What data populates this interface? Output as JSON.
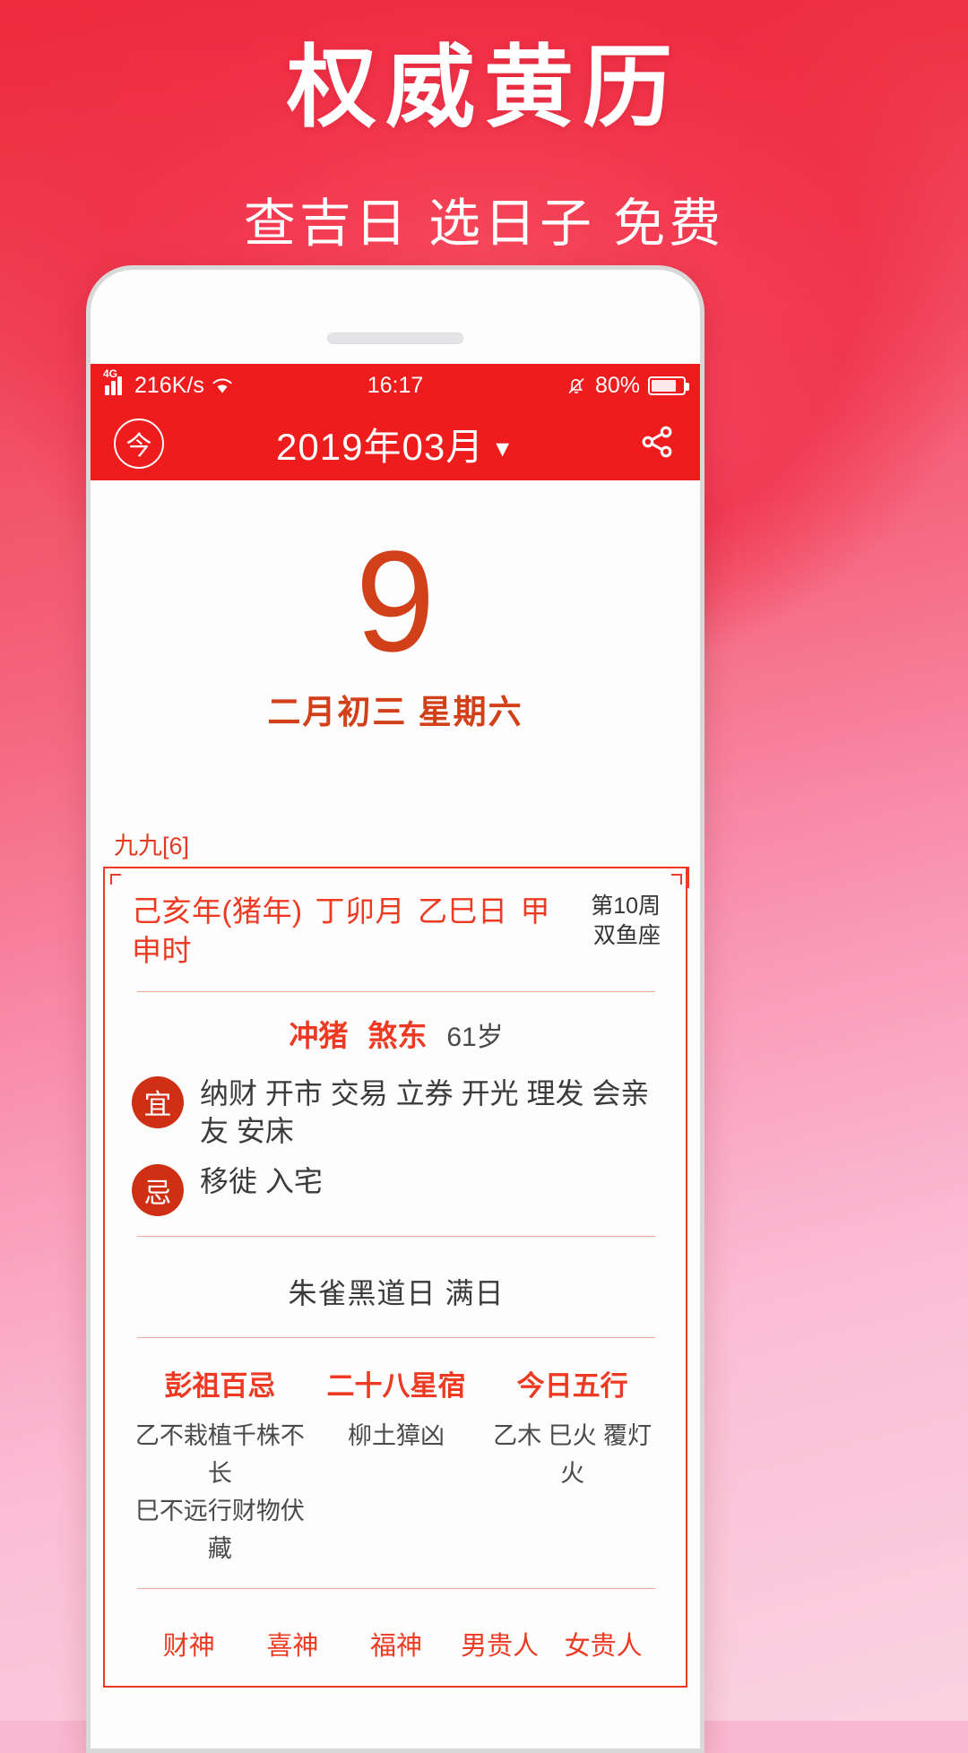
{
  "promo": {
    "title": "权威黄历",
    "subtitle": "查吉日 选日子 免费"
  },
  "colors": {
    "brand_red": "#ee1c1c",
    "accent_orange": "#ee3a22",
    "date_orange": "#d2401a",
    "badge_red": "#cf3014"
  },
  "statusbar": {
    "network_type": "4G",
    "speed": "216K/s",
    "wifi_icon": "wifi-icon",
    "signal_icon": "signal-bars-icon",
    "time": "16:17",
    "mute_icon": "bell-mute-icon",
    "battery_percent": "80%",
    "battery_icon": "battery-icon"
  },
  "appbar": {
    "today_button": "今",
    "title": "2019年03月",
    "caret": "▼",
    "share_icon": "share-icon"
  },
  "bigdate": {
    "day": "9",
    "lunar_and_weekday": "二月初三  星期六"
  },
  "almanac": {
    "jiujiu_label": "九九[6]",
    "ganzhi": [
      "己亥年(猪年)",
      "丁卯月",
      "乙巳日",
      "甲申时"
    ],
    "week_of_year": "第10周",
    "zodiac_sign": "双鱼座",
    "chong": "冲猪",
    "sha": "煞东",
    "age": "61岁",
    "yi_label": "宜",
    "yi_text": "纳财 开市 交易 立券 开光 理发 会亲友 安床",
    "ji_label": "忌",
    "ji_text": "移徙 入宅",
    "huangdao": "朱雀黑道日   满日",
    "columns": [
      {
        "title": "彭祖百忌",
        "lines": [
          "乙不栽植千株不长",
          "巳不远行财物伏藏"
        ]
      },
      {
        "title": "二十八星宿",
        "lines": [
          "柳土獐凶"
        ]
      },
      {
        "title": "今日五行",
        "lines": [
          "乙木 巳火 覆灯火"
        ]
      }
    ],
    "gods": [
      "财神",
      "喜神",
      "福神",
      "男贵人",
      "女贵人"
    ]
  }
}
